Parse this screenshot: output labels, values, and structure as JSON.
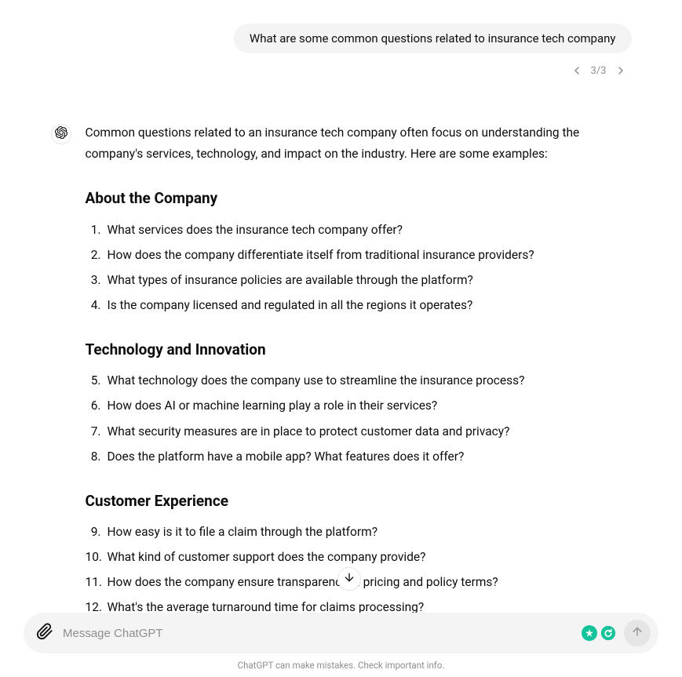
{
  "user_message": "What are some common questions related to insurance tech company",
  "pagination": {
    "current": 3,
    "total": 3,
    "label": "3/3"
  },
  "assistant": {
    "intro": "Common questions related to an insurance tech company often focus on understanding the company's services, technology, and impact on the industry. Here are some examples:",
    "sections": [
      {
        "heading": "About the Company",
        "start": 1,
        "items": [
          "What services does the insurance tech company offer?",
          "How does the company differentiate itself from traditional insurance providers?",
          "What types of insurance policies are available through the platform?",
          "Is the company licensed and regulated in all the regions it operates?"
        ]
      },
      {
        "heading": "Technology and Innovation",
        "start": 5,
        "items": [
          "What technology does the company use to streamline the insurance process?",
          "How does AI or machine learning play a role in their services?",
          "What security measures are in place to protect customer data and privacy?",
          "Does the platform have a mobile app? What features does it offer?"
        ]
      },
      {
        "heading": "Customer Experience",
        "start": 9,
        "items": [
          "How easy is it to file a claim through the platform?",
          "What kind of customer support does the company provide?",
          "How does the company ensure transparency in pricing and policy terms?",
          "What's the average turnaround time for claims processing?"
        ]
      }
    ]
  },
  "composer": {
    "placeholder": "Message ChatGPT"
  },
  "disclaimer": "ChatGPT can make mistakes. Check important info."
}
